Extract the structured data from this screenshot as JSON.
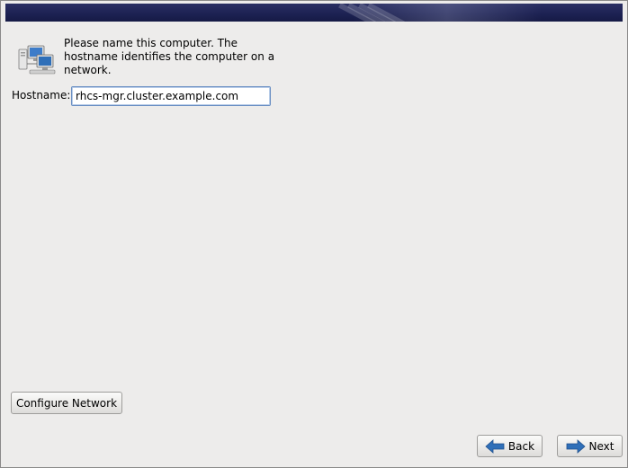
{
  "intro": {
    "line1": "Please name this computer.  The",
    "line2": "hostname identifies the computer on a",
    "line3": "network."
  },
  "hostname": {
    "label": "Hostname:",
    "value": "rhcs-mgr.cluster.example.com"
  },
  "buttons": {
    "configure_network": "Configure Network",
    "back": "Back",
    "next": "Next"
  },
  "icons": {
    "network": "network-computers-icon",
    "back": "arrow-left-icon",
    "next": "arrow-right-icon"
  },
  "colors": {
    "banner": "#1c2152",
    "window_bg": "#edeceb",
    "arrow": "#2f6fb8",
    "input_border": "#6a8fc3"
  }
}
